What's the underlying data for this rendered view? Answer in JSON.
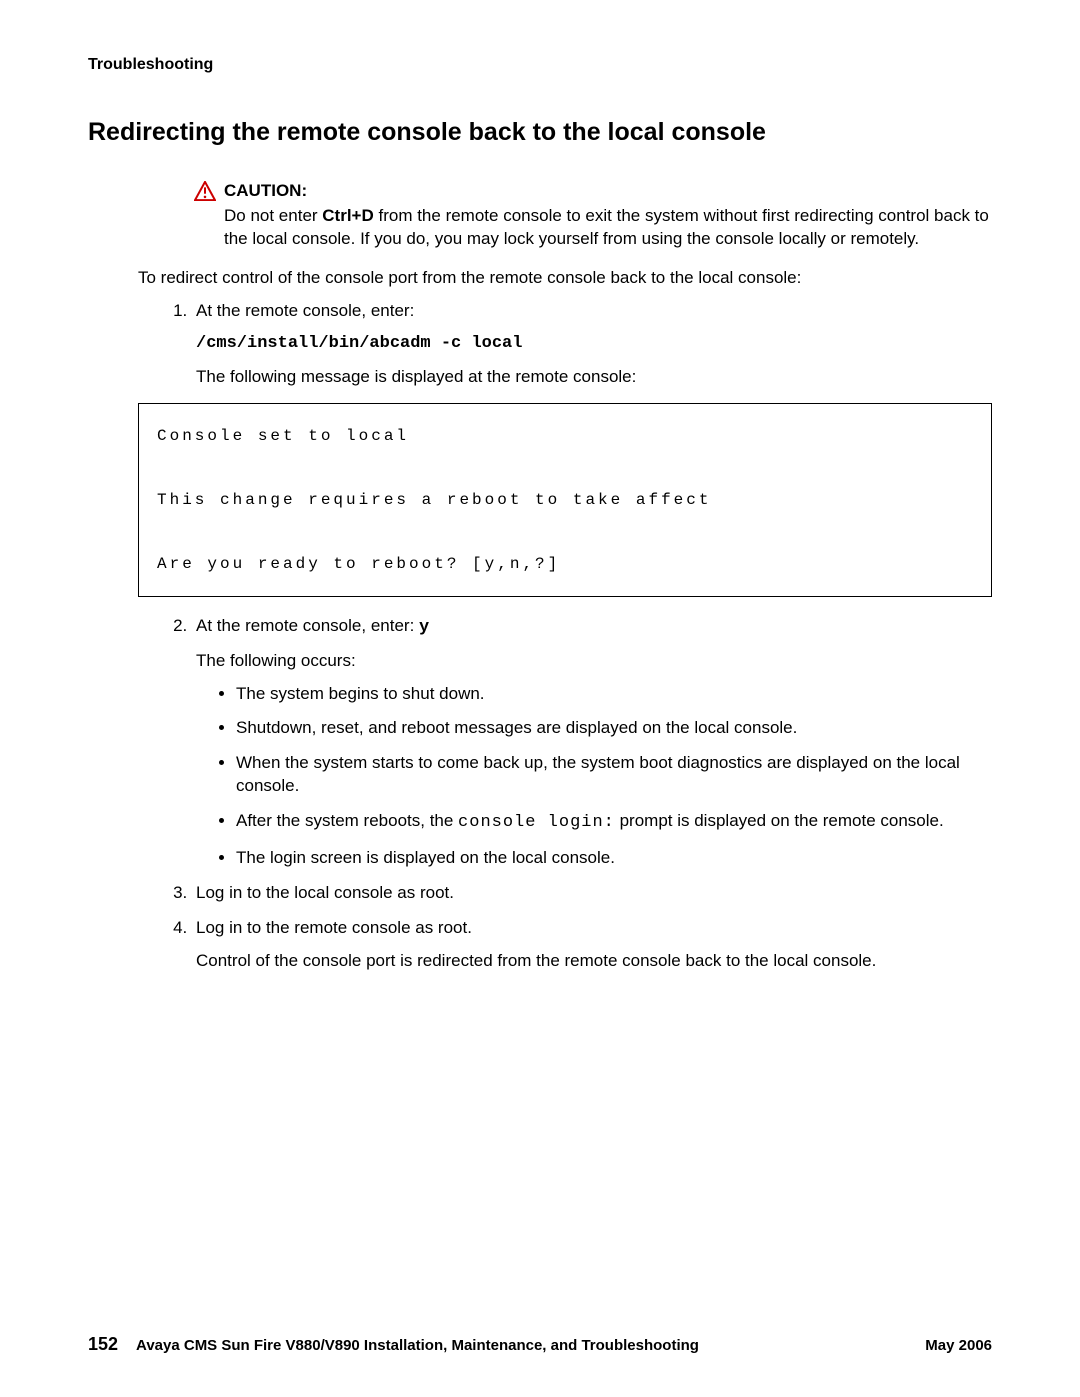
{
  "running_head": "Troubleshooting",
  "title": "Redirecting the remote console back to the local console",
  "caution": {
    "label": "CAUTION:",
    "pre": "Do not enter ",
    "kbd": "Ctrl+D",
    "post": " from the remote console to exit the system without first redirecting control back to the local console. If you do, you may lock yourself from using the console locally or remotely."
  },
  "intro": "To redirect control of the console port from the remote console back to the local console:",
  "step1": {
    "text": "At the remote console, enter:",
    "cmd": "/cms/install/bin/abcadm -c local",
    "after": "The following message is displayed at the remote console:"
  },
  "code_box": "Console set to local\n\nThis change requires a reboot to take affect\n\nAre you ready to reboot? [y,n,?]",
  "step2": {
    "text_pre": "At the remote console, enter: ",
    "input": "y",
    "after": "The following occurs:",
    "bullets": {
      "b1": "The system begins to shut down.",
      "b2": "Shutdown, reset, and reboot messages are displayed on the local console.",
      "b3": "When the system starts to come back up, the system boot diagnostics are displayed on the local console.",
      "b4_pre": "After the system reboots, the ",
      "b4_code": "console login:",
      "b4_post": " prompt is displayed on the remote console.",
      "b5": "The login screen is displayed on the local console."
    }
  },
  "step3": "Log in to the local console as root.",
  "step4": {
    "text": "Log in to the remote console as root.",
    "after": "Control of the console port is redirected from the remote console back to the local console."
  },
  "footer": {
    "page": "152",
    "title": "Avaya CMS Sun Fire V880/V890 Installation, Maintenance, and Troubleshooting",
    "date": "May 2006"
  }
}
